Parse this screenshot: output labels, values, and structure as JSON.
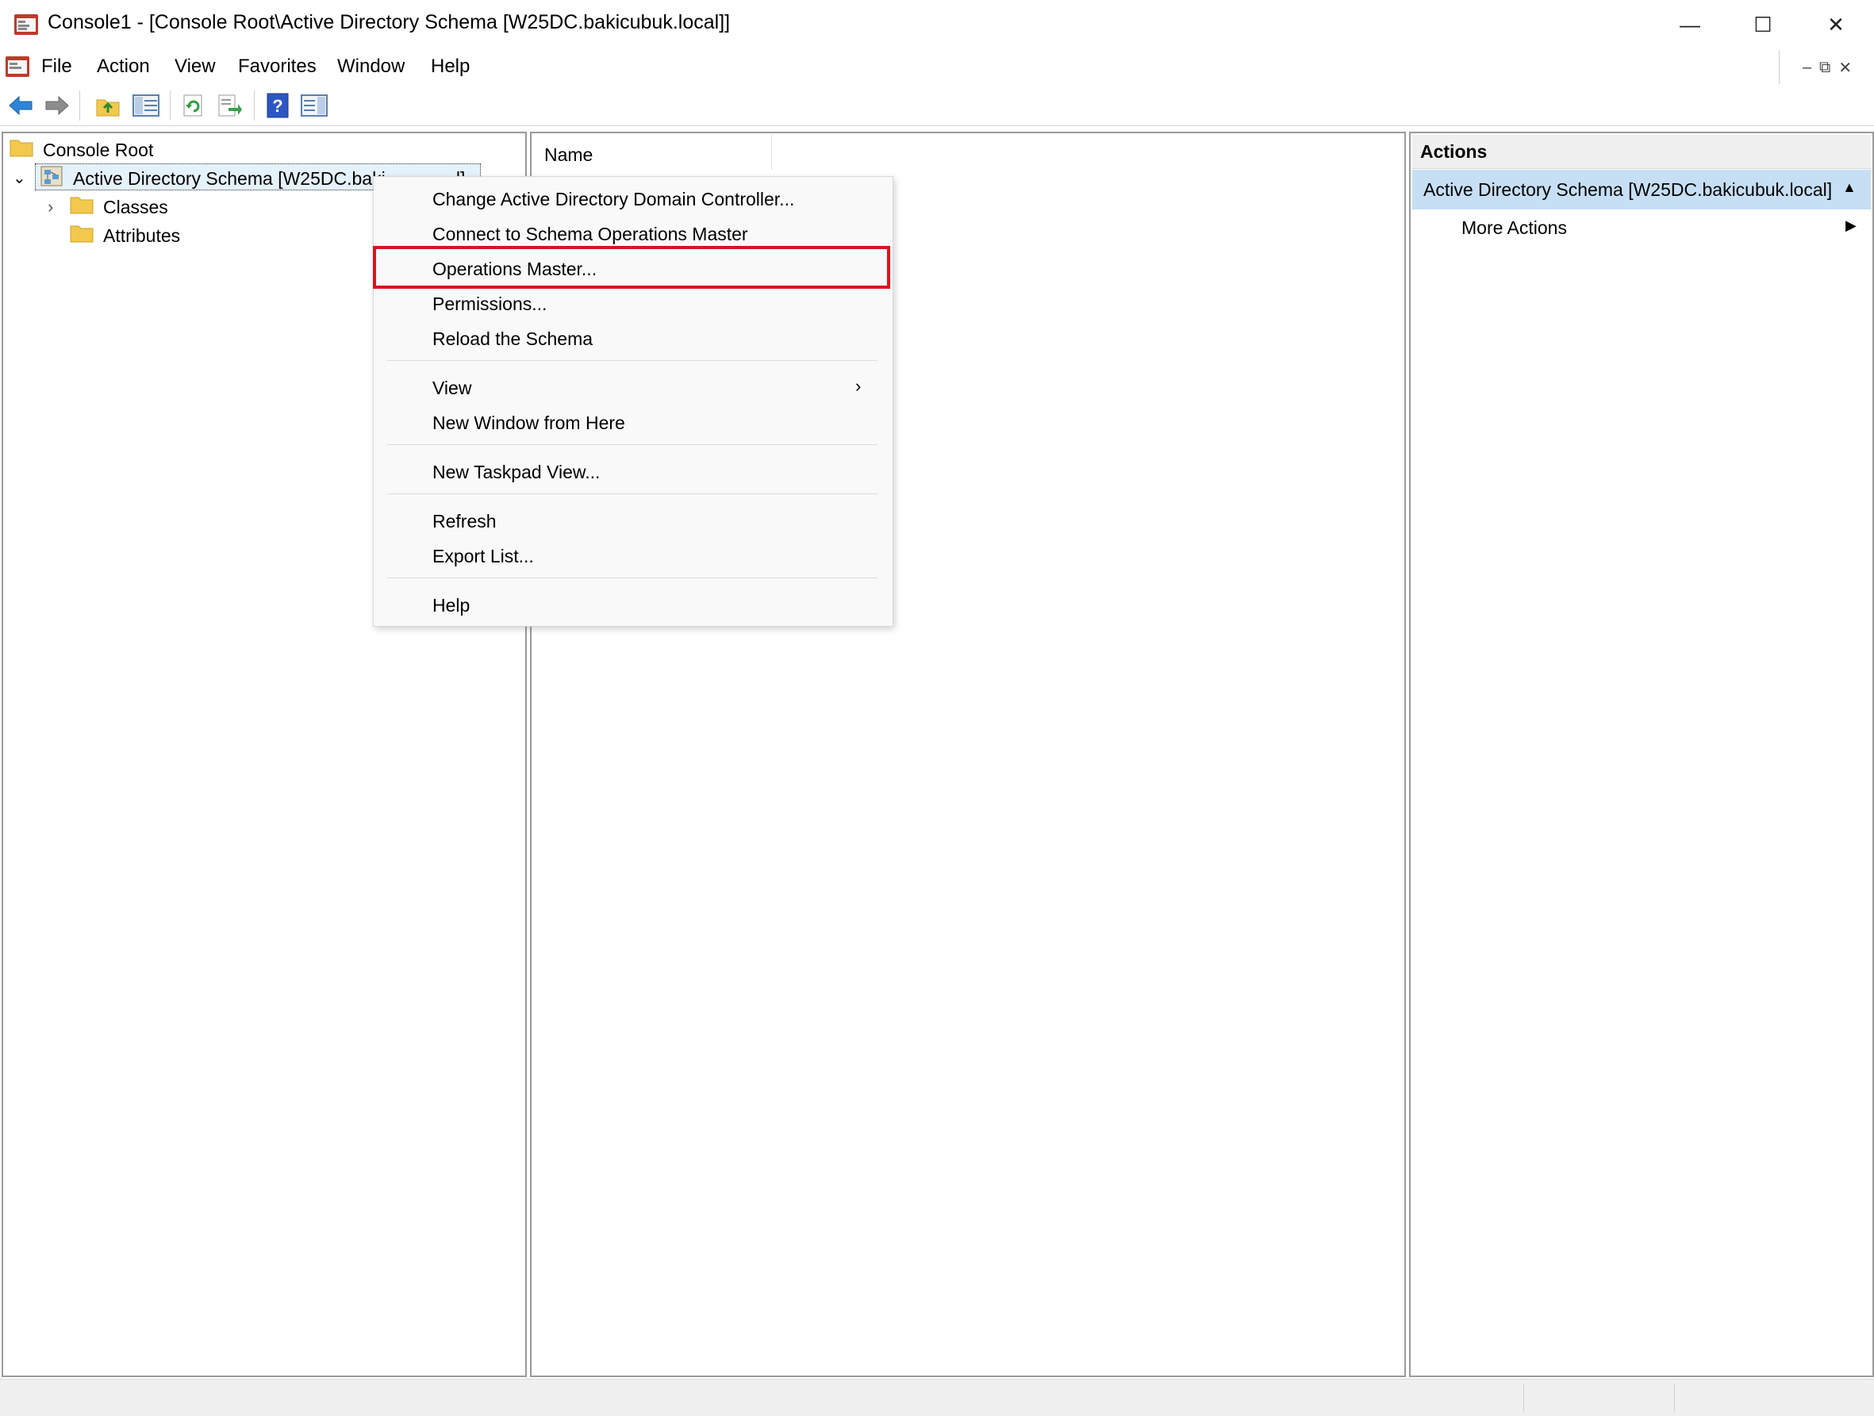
{
  "window": {
    "title": "Console1 - [Console Root\\Active Directory Schema [W25DC.bakicubuk.local]]",
    "controls": [
      "minimize-icon",
      "maximize-icon",
      "close-icon"
    ]
  },
  "menu": {
    "items": [
      "File",
      "Action",
      "View",
      "Favorites",
      "Window",
      "Help"
    ]
  },
  "toolbar": {
    "buttons": [
      "back-icon",
      "forward-icon",
      "up-folder-icon",
      "show-hide-tree-icon",
      "refresh-icon",
      "export-list-icon",
      "help-icon",
      "show-hide-action-pane-icon"
    ]
  },
  "tree": {
    "root": "Console Root",
    "schema_node": "Active Directory Schema [W25DC.baki",
    "schema_node_tail": "...l]",
    "children": [
      "Classes",
      "Attributes"
    ]
  },
  "content": {
    "column_name": "Name"
  },
  "context_menu": {
    "items": [
      "Change Active Directory Domain Controller...",
      "Connect to Schema Operations Master",
      "Operations Master...",
      "Permissions...",
      "Reload the Schema",
      "View",
      "New Window from Here",
      "New Taskpad View...",
      "Refresh",
      "Export List...",
      "Help"
    ],
    "highlighted": "Operations Master...",
    "highlight_color": "#d9141d"
  },
  "actions": {
    "title": "Actions",
    "selected": "Active Directory Schema [W25DC.bakicubuk.local]",
    "more": "More Actions"
  },
  "colors": {
    "selection": "#c6dff5",
    "highlight_border": "#d9141d"
  }
}
